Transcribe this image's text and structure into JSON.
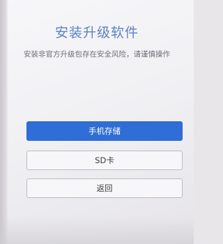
{
  "dialog": {
    "title": "安装升级软件",
    "subtitle": "安装非官方升级包存在安全风险，请谨慎操作"
  },
  "buttons": {
    "phone_storage": "手机存储",
    "sd_card": "SD卡",
    "back": "返回"
  },
  "colors": {
    "title": "#5a82c2",
    "primary_button": "#2f6ed6",
    "background": "#f3f3f6"
  }
}
